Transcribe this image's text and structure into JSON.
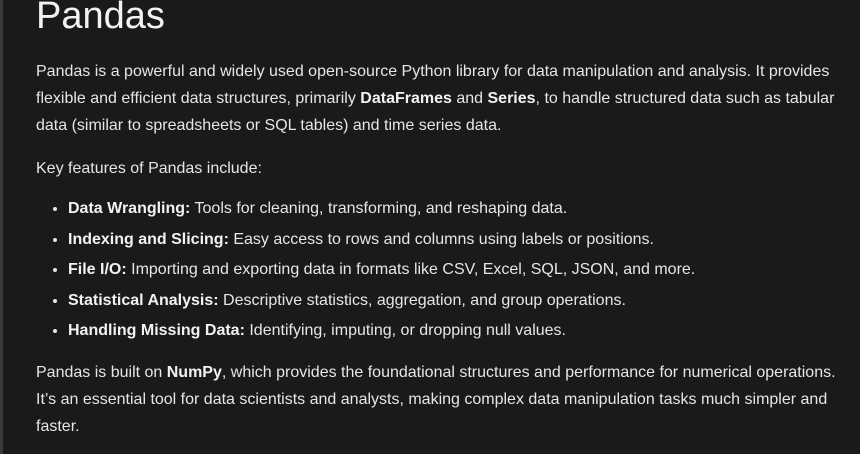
{
  "title": "Pandas",
  "intro": {
    "part1": "Pandas is a powerful and widely used open-source Python library for data manipulation and analysis. It provides flexible and efficient data structures, primarily ",
    "bold1": "DataFrames",
    "part2": " and ",
    "bold2": "Series",
    "part3": ", to handle structured data such as tabular data (similar to spreadsheets or SQL tables) and time series data."
  },
  "key_features_heading": "Key features of Pandas include:",
  "features": [
    {
      "label": "Data Wrangling:",
      "text": " Tools for cleaning, transforming, and reshaping data."
    },
    {
      "label": "Indexing and Slicing:",
      "text": " Easy access to rows and columns using labels or positions."
    },
    {
      "label": "File I/O:",
      "text": " Importing and exporting data in formats like CSV, Excel, SQL, JSON, and more."
    },
    {
      "label": "Statistical Analysis:",
      "text": " Descriptive statistics, aggregation, and group operations."
    },
    {
      "label": "Handling Missing Data:",
      "text": " Identifying, imputing, or dropping null values."
    }
  ],
  "outro": {
    "part1": "Pandas is built on ",
    "bold1": "NumPy",
    "part2": ", which provides the foundational structures and performance for numerical operations. It’s an essential tool for data scientists and analysts, making complex data manipulation tasks much simpler and faster."
  }
}
